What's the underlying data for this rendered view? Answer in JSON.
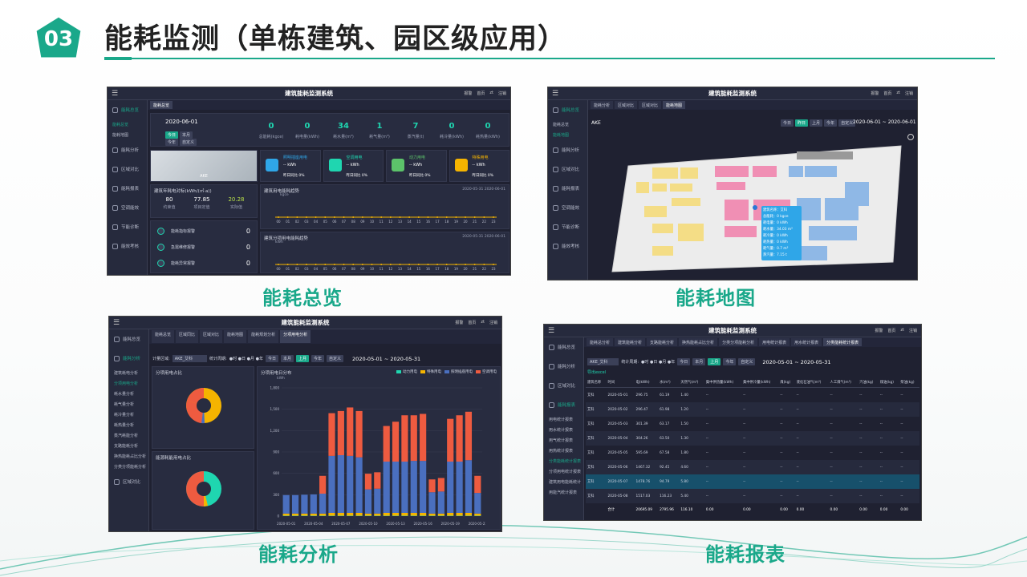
{
  "slide": {
    "badge": "03",
    "title": "能耗监测（单栋建筑、园区级应用）",
    "captions": {
      "overview": "能耗总览",
      "map": "能耗地图",
      "analysis": "能耗分析",
      "report": "能耗报表"
    },
    "accent": "#1aa88a"
  },
  "app": {
    "title": "建筑能耗监测系统",
    "toolbar": {
      "alarm": "报警",
      "home": "首页",
      "user": "zt",
      "logout": "注销"
    },
    "sidebar": [
      "能耗总览",
      "能耗分析",
      "区域对比",
      "能耗报表",
      "空调能效",
      "节能诊断",
      "能效考核"
    ],
    "sidebar_sub_overview": [
      "能耗总览",
      "能耗地图"
    ]
  },
  "overview": {
    "tab": "能耗总览",
    "date": "2020-06-01",
    "buttons": [
      "今日",
      "本月",
      "今年",
      "自定义"
    ],
    "kpis": [
      {
        "value": "0",
        "label": "总能耗(kgce)"
      },
      {
        "value": "0",
        "label": "耗电量(kWh)"
      },
      {
        "value": "34",
        "label": "耗水量(m³)"
      },
      {
        "value": "1",
        "label": "耗气量(m³)"
      },
      {
        "value": "7",
        "label": "蒸汽量(t)"
      },
      {
        "value": "0",
        "label": "耗冷量(kWh)"
      },
      {
        "value": "0",
        "label": "耗热量(kWh)"
      }
    ],
    "photo_caption": "AKE",
    "cards": [
      {
        "name": "照明插座用电",
        "value": "-- kWh",
        "ratio": "昨日同比 0%"
      },
      {
        "name": "空调用电",
        "value": "-- kWh",
        "ratio": "昨日同比 0%"
      },
      {
        "name": "动力用电",
        "value": "-- kWh",
        "ratio": "昨日同比 0%"
      },
      {
        "name": "特殊用电",
        "value": "-- kWh",
        "ratio": "昨日同比 0%"
      }
    ],
    "quota_title": "建筑年耗电对标(kWh/(㎡·a))",
    "quota": [
      {
        "value": "80",
        "label": "约束值"
      },
      {
        "value": "77.85",
        "label": "项目定值"
      },
      {
        "value": "20.28",
        "label": "实际值"
      }
    ],
    "alarms": [
      {
        "label": "能耗指标报警",
        "value": "0"
      },
      {
        "label": "急需维修报警",
        "value": "0"
      },
      {
        "label": "能耗异常报警",
        "value": "0"
      }
    ],
    "chart1_title": "建筑用电能耗趋势",
    "chart1_unit": "kgce",
    "chart1_legend": [
      "2020-05-31",
      "2020-06-01"
    ],
    "chart2_title": "建筑分项用电能耗趋势",
    "chart2_unit": "kWh",
    "chart2_legend": [
      "2020-05-31",
      "2020-06-01"
    ],
    "hours": [
      "00",
      "01",
      "02",
      "03",
      "04",
      "05",
      "06",
      "07",
      "08",
      "09",
      "10",
      "11",
      "12",
      "13",
      "14",
      "15",
      "16",
      "17",
      "18",
      "19",
      "20",
      "21",
      "22",
      "23"
    ]
  },
  "map": {
    "tabs": [
      "能耗分析",
      "区域对比",
      "区域对比",
      "能耗地图"
    ],
    "site": "AKE",
    "buttons": [
      "今日",
      "昨日",
      "上月",
      "今年",
      "自定义"
    ],
    "range": "2020-06-01 ~ 2020-06-01",
    "tooltip": [
      "建筑名称：艾科",
      "总能耗：0 kgce",
      "耗电量：0 kWh",
      "耗水量：34.03 m³",
      "耗冷量：0 kWh",
      "耗热量：0 kWh",
      "耗气量：0.7 m³",
      "蒸汽量：7.15 t"
    ]
  },
  "analysis": {
    "tabs": [
      "能耗总览",
      "区域同比",
      "区域对比",
      "能耗地图",
      "能耗规划分析",
      "分项用电分析"
    ],
    "area_label": "计量区域:",
    "area_value": "AKE_艾科",
    "period_label": "统计周期:",
    "period_opts": "●时 ●日 ●月 ●年",
    "buttons": [
      "今日",
      "本月",
      "上月",
      "今年",
      "自定义"
    ],
    "range": "2020-05-01 ~ 2020-05-31",
    "sub": [
      "建筑耗电分析",
      "分项用电分析",
      "耗水量分析",
      "耗气量分析",
      "耗冷量分析",
      "耗热量分析",
      "蒸汽耗能分析",
      "支路能耗分析",
      "换热能耗占比分析",
      "分类分项能耗分析"
    ],
    "pie1_title": "分项用电占比",
    "pie2_title": "能源耗能用电占比",
    "chart_title": "分项用电日分布",
    "unit": "kWh",
    "legend": [
      "动力用电",
      "特殊用电",
      "照明插座用电",
      "空调用电"
    ],
    "xticks": [
      "2020-05-01",
      "2020-05-04",
      "2020-05-07",
      "2020-05-10",
      "2020-05-13",
      "2020-05-16",
      "2020-05-19",
      "2020-05-22"
    ],
    "yticks": [
      "0",
      "300",
      "600",
      "900",
      "1,200",
      "1,500",
      "1,800"
    ]
  },
  "report": {
    "tabs": [
      "能耗总分析",
      "建筑能耗分析",
      "支路能耗分析",
      "换热能耗占比分析",
      "分类分项能耗分析",
      "用电统计报表",
      "用水统计报表",
      "分类能耗统计报表"
    ],
    "area_value": "AKE_艾科",
    "period_label": "统计周期:",
    "period_opts": "●时 ●日 ●月 ●年",
    "buttons": [
      "今日",
      "本月",
      "上月",
      "今年",
      "自定义"
    ],
    "range": "2020-05-01 ~ 2020-05-31",
    "export": "导出excel",
    "sub": [
      "用电统计报表",
      "用水统计报表",
      "用气统计报表",
      "用热统计报表",
      "分类能耗统计报表",
      "分项用电统计报表",
      "建筑用电能耗统计",
      "用能汽统计报表"
    ],
    "columns": [
      "建筑名称",
      "时间",
      "电(kWh)",
      "水(m³)",
      "天然气(m³)",
      "集中供热量(kWh)",
      "集中供冷量(kWh)",
      "煤(kg)",
      "液化石油气(m³)",
      "人工煤气(m³)",
      "汽油(kg)",
      "煤油(kg)",
      "柴油(kg)"
    ],
    "rows": [
      [
        "艾科",
        "2020-05-01",
        "296.75",
        "61.19",
        "1.40",
        "--",
        "--",
        "--",
        "--",
        "--",
        "--",
        "--",
        "--"
      ],
      [
        "艾科",
        "2020-05-02",
        "296.47",
        "61.98",
        "1.20",
        "--",
        "--",
        "--",
        "--",
        "--",
        "--",
        "--",
        "--"
      ],
      [
        "艾科",
        "2020-05-03",
        "301.39",
        "63.17",
        "1.50",
        "--",
        "--",
        "--",
        "--",
        "--",
        "--",
        "--",
        "--"
      ],
      [
        "艾科",
        "2020-05-04",
        "304.26",
        "63.50",
        "1.30",
        "--",
        "--",
        "--",
        "--",
        "--",
        "--",
        "--",
        "--"
      ],
      [
        "艾科",
        "2020-05-05",
        "595.69",
        "67.58",
        "1.80",
        "--",
        "--",
        "--",
        "--",
        "--",
        "--",
        "--",
        "--"
      ],
      [
        "艾科",
        "2020-05-06",
        "1467.32",
        "92.45",
        "4.60",
        "--",
        "--",
        "--",
        "--",
        "--",
        "--",
        "--",
        "--"
      ],
      [
        "艾科",
        "2020-05-07",
        "1478.76",
        "94.79",
        "5.80",
        "--",
        "--",
        "--",
        "--",
        "--",
        "--",
        "--",
        "--"
      ],
      [
        "艾科",
        "2020-05-08",
        "1517.03",
        "116.23",
        "5.40",
        "--",
        "--",
        "--",
        "--",
        "--",
        "--",
        "--",
        "--"
      ]
    ],
    "total": [
      "",
      "合计",
      "20695.09",
      "2795.96",
      "116.10",
      "0.00",
      "0.00",
      "0.00",
      "0.00",
      "0.00",
      "0.00",
      "0.00",
      "0.00"
    ]
  },
  "chart_data": {
    "type": "bar",
    "title": "分项用电日分布",
    "ylabel": "kWh",
    "ylim": [
      0,
      1800
    ],
    "categories": [
      "2020-05-01",
      "2020-05-02",
      "2020-05-03",
      "2020-05-04",
      "2020-05-05",
      "2020-05-06",
      "2020-05-07",
      "2020-05-08",
      "2020-05-09",
      "2020-05-10",
      "2020-05-11",
      "2020-05-12",
      "2020-05-13",
      "2020-05-14",
      "2020-05-15",
      "2020-05-16",
      "2020-05-17",
      "2020-05-18",
      "2020-05-19",
      "2020-05-20",
      "2020-05-21",
      "2020-05-22"
    ],
    "series": [
      {
        "name": "动力用电",
        "color": "#1fd6b0",
        "values": [
          5,
          5,
          5,
          5,
          5,
          5,
          5,
          5,
          5,
          5,
          5,
          5,
          5,
          5,
          5,
          5,
          5,
          5,
          5,
          5,
          5,
          5
        ]
      },
      {
        "name": "特殊用电",
        "color": "#f5b400",
        "values": [
          30,
          30,
          30,
          30,
          30,
          40,
          40,
          40,
          40,
          30,
          30,
          40,
          40,
          40,
          40,
          40,
          30,
          30,
          40,
          40,
          40,
          30
        ]
      },
      {
        "name": "照明插座用电",
        "color": "#4a6fbf",
        "values": [
          260,
          260,
          265,
          270,
          280,
          800,
          810,
          800,
          780,
          340,
          350,
          720,
          720,
          720,
          730,
          730,
          300,
          310,
          720,
          720,
          740,
          290
        ]
      },
      {
        "name": "空调用电",
        "color": "#ee5b40",
        "values": [
          0,
          0,
          0,
          0,
          250,
          600,
          620,
          680,
          650,
          220,
          230,
          500,
          560,
          650,
          640,
          660,
          180,
          190,
          600,
          650,
          680,
          240
        ]
      }
    ]
  }
}
